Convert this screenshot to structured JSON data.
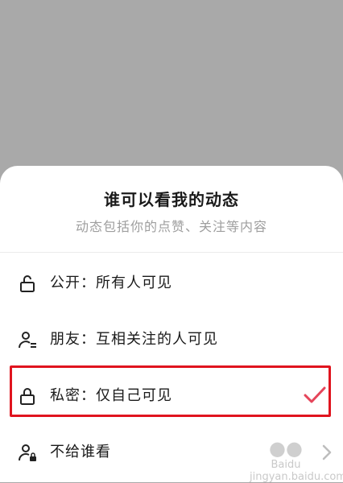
{
  "sheet": {
    "title": "谁可以看我的动态",
    "subtitle": "动态包括你的点赞、关注等内容"
  },
  "options": [
    {
      "icon": "unlock-icon",
      "label": "公开：所有人可见",
      "selected": false
    },
    {
      "icon": "friends-icon",
      "label": "朋友：互相关注的人可见",
      "selected": false
    },
    {
      "icon": "lock-icon",
      "label": "私密：仅自己可见",
      "selected": true
    },
    {
      "icon": "user-block-icon",
      "label": "不给谁看",
      "selected": false
    }
  ],
  "watermark": {
    "lines": [
      "Baidu",
      "jingyan.baidu.com"
    ]
  },
  "colors": {
    "overlay": "#a9a9a9",
    "check": "#e5455a",
    "highlight_box": "#e0141e"
  }
}
